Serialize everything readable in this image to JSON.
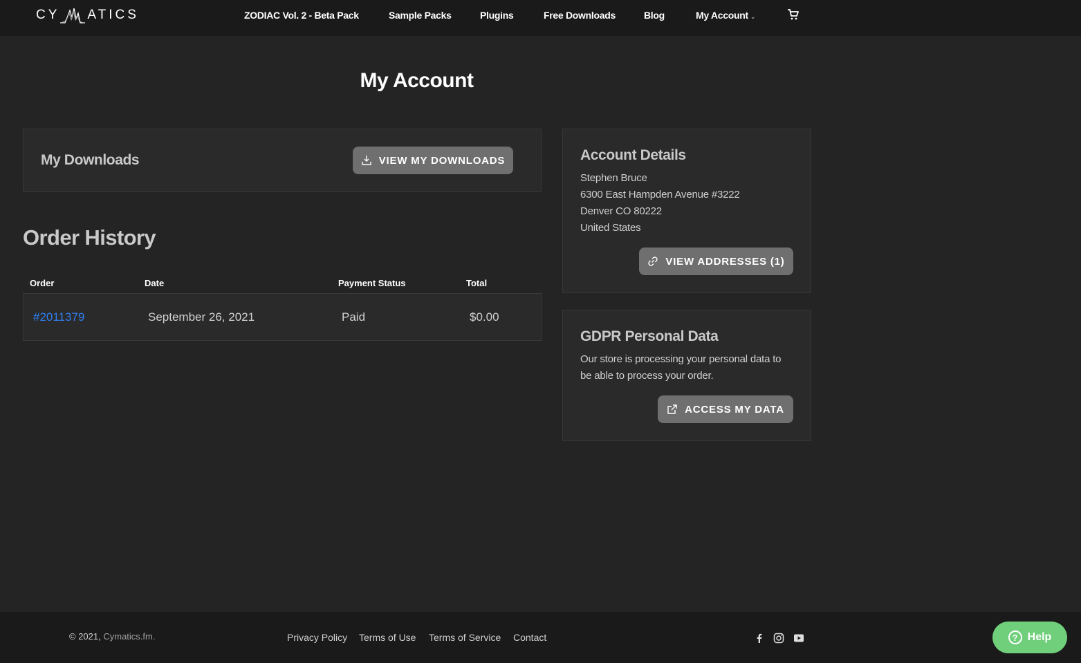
{
  "header": {
    "logo_left": "CY",
    "logo_right": "ATICS",
    "nav": [
      {
        "label": "ZODIAC Vol. 2 - Beta Pack"
      },
      {
        "label": "Sample Packs"
      },
      {
        "label": "Plugins"
      },
      {
        "label": "Free Downloads"
      },
      {
        "label": "Blog"
      },
      {
        "label": "My Account"
      }
    ],
    "account_caret": "⌄",
    "cart_icon": "cart-icon"
  },
  "page": {
    "title": "My Account"
  },
  "downloads": {
    "heading": "My Downloads",
    "button_label": "VIEW MY DOWNLOADS",
    "button_icon": "download-icon"
  },
  "orders": {
    "heading": "Order History",
    "columns": [
      "Order",
      "Date",
      "Payment Status",
      "Total"
    ],
    "rows": [
      {
        "order": "#2011379",
        "date": "September 26, 2021",
        "status": "Paid",
        "total": "$0.00"
      }
    ],
    "link_color": "#2f7ff0"
  },
  "account_details": {
    "heading": "Account Details",
    "lines": [
      "Stephen Bruce",
      "6300 East Hampden Avenue #3222",
      "Denver CO 80222",
      "United States"
    ],
    "button_label": "VIEW ADDRESSES (1)",
    "button_icon": "link-icon"
  },
  "gdpr": {
    "heading": "GDPR Personal Data",
    "lines": [
      "Our store is processing your personal data to",
      "be able to process your order."
    ],
    "button_label": "ACCESS MY DATA",
    "button_icon": "external-link-icon"
  },
  "footer": {
    "copyright_prefix": "© 2021,",
    "copyright_site": "Cymatics.fm.",
    "links": [
      "Privacy Policy",
      "Terms of Use",
      "Terms of Service",
      "Contact"
    ],
    "social_icons": [
      "facebook-icon",
      "instagram-icon",
      "youtube-icon"
    ]
  },
  "help": {
    "label": "Help",
    "glyph": "?",
    "color": "#6fcf7a"
  }
}
